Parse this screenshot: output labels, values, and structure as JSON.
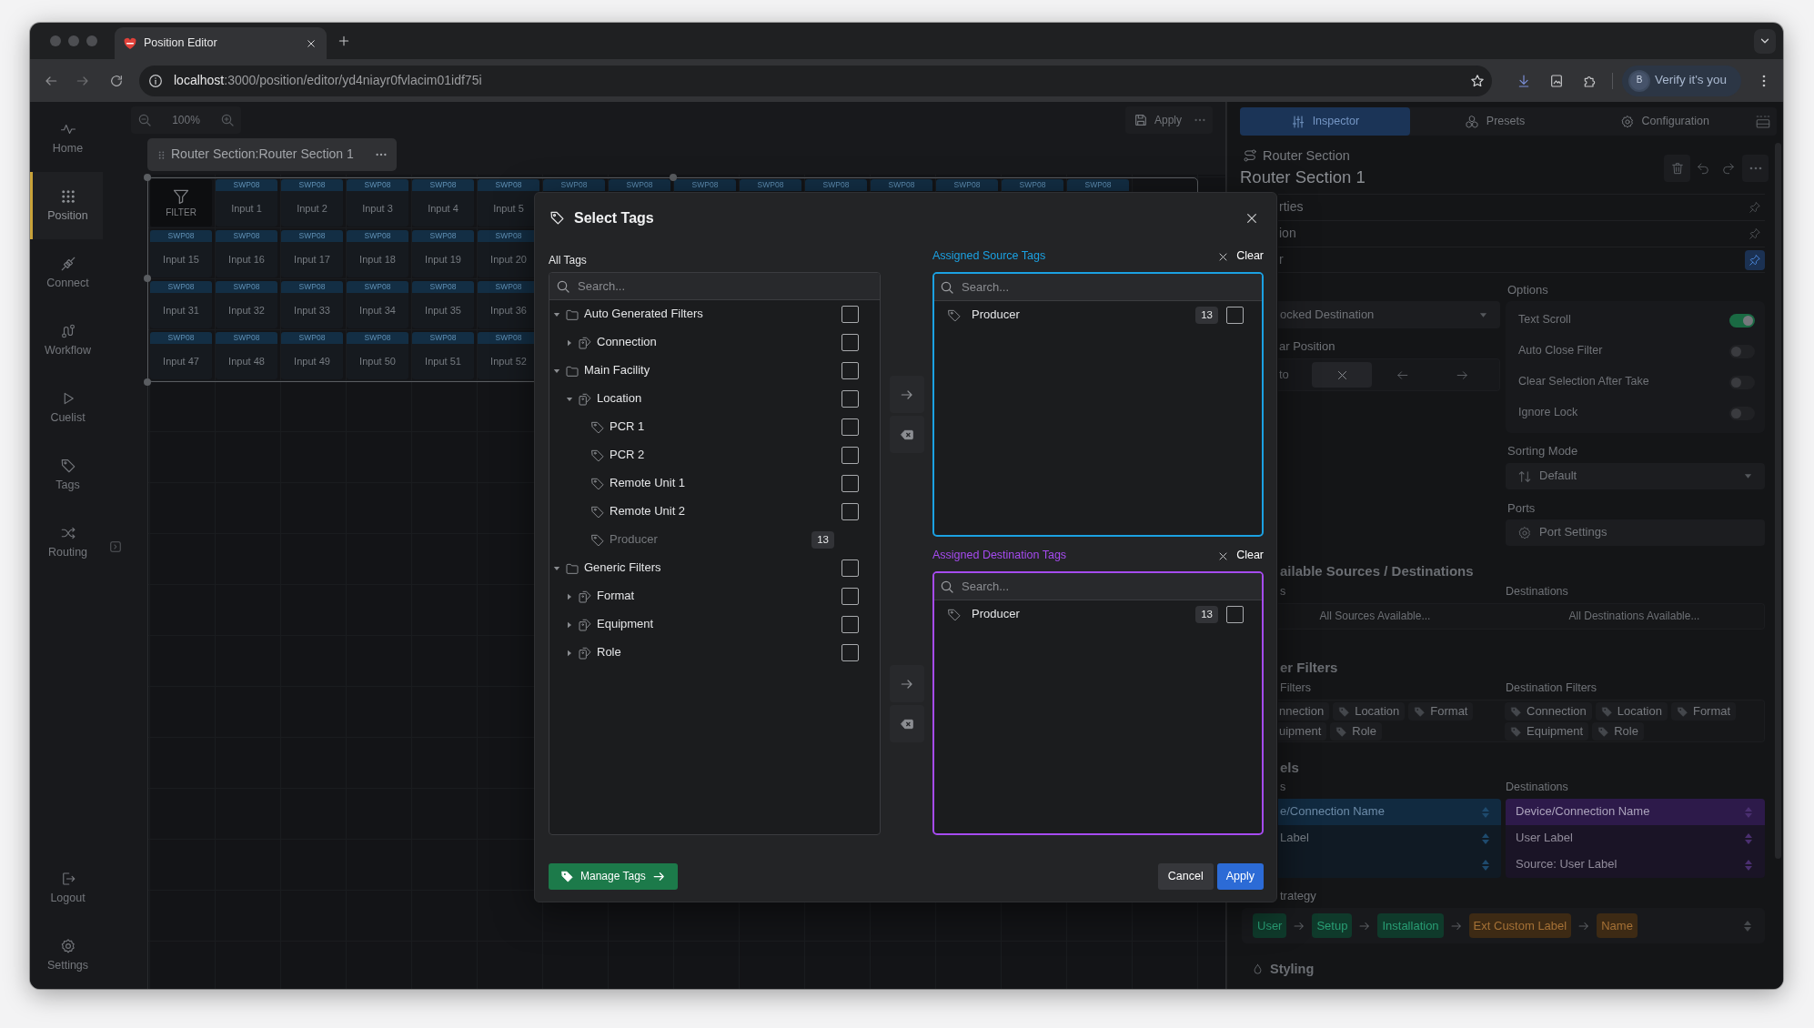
{
  "browser": {
    "tabs": [
      {
        "title": "Position Editor",
        "selected": true
      }
    ],
    "url": {
      "host": "localhost",
      "path": ":3000/position/editor/yd4niayr0fvlacim01idf75i"
    },
    "profile": {
      "initial": "B",
      "label": "Verify it's you"
    }
  },
  "sidebar": {
    "items": [
      {
        "label": "Home",
        "selected": false
      },
      {
        "label": "Position",
        "selected": true
      },
      {
        "label": "Connect",
        "selected": false
      },
      {
        "label": "Workflow",
        "selected": false
      },
      {
        "label": "Cuelist",
        "selected": false
      },
      {
        "label": "Tags",
        "selected": false
      },
      {
        "label": "Routing",
        "selected": false
      }
    ],
    "footer": [
      {
        "label": "Logout"
      },
      {
        "label": "Settings"
      }
    ]
  },
  "canvas": {
    "zoom": "100%",
    "apply": "Apply",
    "section_tab": "Router Section:Router Section 1",
    "rows": [
      [
        {
          "kind": "filter",
          "label": "FILTER"
        },
        {
          "kind": "input",
          "device": "SWP08",
          "label": "Input 1"
        },
        {
          "kind": "input",
          "device": "SWP08",
          "label": "Input 2"
        },
        {
          "kind": "input",
          "device": "SWP08",
          "label": "Input 3"
        },
        {
          "kind": "input",
          "device": "SWP08",
          "label": "Input 4"
        },
        {
          "kind": "input",
          "device": "SWP08",
          "label": "Input 5"
        },
        {
          "kind": "input",
          "device": "SWP08"
        },
        {
          "kind": "input",
          "device": "SWP08"
        },
        {
          "kind": "input",
          "device": "SWP08"
        },
        {
          "kind": "input",
          "device": "SWP08"
        },
        {
          "kind": "input",
          "device": "SWP08"
        },
        {
          "kind": "input",
          "device": "SWP08"
        },
        {
          "kind": "input",
          "device": "SWP08"
        },
        {
          "kind": "input",
          "device": "SWP08"
        },
        {
          "kind": "input",
          "device": "SWP08"
        }
      ],
      [
        {
          "kind": "input",
          "device": "SWP08",
          "label": "Input 15"
        },
        {
          "kind": "input",
          "device": "SWP08",
          "label": "Input 16"
        },
        {
          "kind": "input",
          "device": "SWP08",
          "label": "Input 17"
        },
        {
          "kind": "input",
          "device": "SWP08",
          "label": "Input 18"
        },
        {
          "kind": "input",
          "device": "SWP08",
          "label": "Input 19"
        },
        {
          "kind": "input",
          "device": "SWP08",
          "label": "Input 20"
        }
      ],
      [
        {
          "kind": "input",
          "device": "SWP08",
          "label": "Input 31"
        },
        {
          "kind": "input",
          "device": "SWP08",
          "label": "Input 32"
        },
        {
          "kind": "input",
          "device": "SWP08",
          "label": "Input 33"
        },
        {
          "kind": "input",
          "device": "SWP08",
          "label": "Input 34"
        },
        {
          "kind": "input",
          "device": "SWP08",
          "label": "Input 35"
        },
        {
          "kind": "input",
          "device": "SWP08",
          "label": "Input 36"
        }
      ],
      [
        {
          "kind": "input",
          "device": "SWP08",
          "label": "Input 47"
        },
        {
          "kind": "input",
          "device": "SWP08",
          "label": "Input 48"
        },
        {
          "kind": "input",
          "device": "SWP08",
          "label": "Input 49"
        },
        {
          "kind": "input",
          "device": "SWP08",
          "label": "Input 50"
        },
        {
          "kind": "input",
          "device": "SWP08",
          "label": "Input 51"
        },
        {
          "kind": "input",
          "device": "SWP08",
          "label": "Input 52"
        }
      ]
    ]
  },
  "dialog": {
    "title": "Select Tags",
    "all_tags": {
      "label": "All Tags",
      "search_placeholder": "Search...",
      "tree": [
        {
          "kind": "folder",
          "label": "Auto Generated Filters",
          "expanded": true,
          "checked": false,
          "children": [
            {
              "kind": "group",
              "label": "Connection",
              "expanded": false,
              "checked": false
            }
          ]
        },
        {
          "kind": "folder",
          "label": "Main Facility",
          "expanded": true,
          "checked": false,
          "children": [
            {
              "kind": "group",
              "label": "Location",
              "expanded": true,
              "checked": false,
              "children": [
                {
                  "kind": "tag",
                  "label": "PCR 1",
                  "disabled": false,
                  "checked": false
                },
                {
                  "kind": "tag",
                  "label": "PCR 2",
                  "disabled": false,
                  "checked": false
                },
                {
                  "kind": "tag",
                  "label": "Remote Unit 1",
                  "disabled": false,
                  "checked": false
                },
                {
                  "kind": "tag",
                  "label": "Remote Unit 2",
                  "disabled": false,
                  "checked": false
                },
                {
                  "kind": "tag",
                  "label": "Producer",
                  "disabled": true,
                  "count": "13"
                }
              ]
            }
          ]
        },
        {
          "kind": "folder",
          "label": "Generic Filters",
          "expanded": true,
          "checked": false,
          "children": [
            {
              "kind": "group",
              "label": "Format",
              "expanded": false,
              "checked": false
            },
            {
              "kind": "group",
              "label": "Equipment",
              "expanded": false,
              "checked": false
            },
            {
              "kind": "group",
              "label": "Role",
              "expanded": false,
              "checked": false
            }
          ]
        }
      ]
    },
    "assigned": [
      {
        "label": "Assigned Source Tags",
        "color": "#1ba1e2",
        "clear": "Clear",
        "search_placeholder": "Search...",
        "items": [
          {
            "label": "Producer",
            "count": "13",
            "checked": false
          }
        ]
      },
      {
        "label": "Assigned Destination Tags",
        "color": "#a64bf0",
        "clear": "Clear",
        "search_placeholder": "Search...",
        "items": [
          {
            "label": "Producer",
            "count": "13",
            "checked": false
          }
        ]
      }
    ],
    "manage": "Manage Tags",
    "cancel": "Cancel",
    "apply": "Apply"
  },
  "inspector": {
    "tabs": [
      {
        "label": "Inspector",
        "selected": true
      },
      {
        "label": "Presets",
        "selected": false
      },
      {
        "label": "Configuration",
        "selected": false
      }
    ],
    "type": "Router Section",
    "title": "Router Section 1",
    "sections": [
      {
        "label": "rties",
        "pinned": false
      },
      {
        "label": "ion",
        "pinned": false
      },
      {
        "label": "r",
        "pinned": true
      }
    ],
    "destination_mode": {
      "value": "ocked Destination"
    },
    "position": {
      "label": "ar Position",
      "options": [
        {
          "kind": "text",
          "label": "to",
          "selected": false
        },
        {
          "kind": "clear",
          "selected": true
        },
        {
          "kind": "left",
          "selected": false
        },
        {
          "kind": "right",
          "selected": false
        }
      ]
    },
    "options": {
      "label": "Options",
      "items": [
        {
          "label": "Text Scroll",
          "on": true
        },
        {
          "label": "Auto Close Filter",
          "on": false
        },
        {
          "label": "Clear Selection After Take",
          "on": false
        },
        {
          "label": "Ignore Lock",
          "on": false
        }
      ]
    },
    "sorting": {
      "label": "Sorting Mode",
      "value": "Default"
    },
    "ports": {
      "label": "Ports",
      "button": "Port Settings"
    },
    "available": {
      "heading": "ailable Sources / Destinations",
      "sources_label": "s",
      "destinations_label": "Destinations",
      "sources_value": "All Sources Available...",
      "destinations_value": "All Destinations Available..."
    },
    "filters": {
      "heading": "er Filters",
      "sources_label": "Filters",
      "destinations_label": "Destination Filters",
      "source_rows": [
        [
          "nnection",
          "Location",
          "Format"
        ],
        [
          "uipment",
          "Role"
        ]
      ],
      "destination_rows": [
        [
          "Connection",
          "Location",
          "Format"
        ],
        [
          "Equipment",
          "Role"
        ]
      ]
    },
    "labels": {
      "heading": "els",
      "sources_label": "s",
      "destinations_label": "Destinations",
      "sources": [
        {
          "label": "e/Connection Name",
          "selected": true
        },
        {
          "label": "Label",
          "selected": false
        },
        {
          "selected": false
        }
      ],
      "destinations": [
        {
          "label": "Device/Connection Name",
          "selected": true
        },
        {
          "label": "User Label",
          "selected": false
        },
        {
          "label": "Source: User Label",
          "selected": false
        }
      ]
    },
    "strategy": {
      "label": "trategy",
      "chips": [
        {
          "label": "User",
          "color": "#0f3a2b"
        },
        {
          "label": "Setup",
          "color": "#0f3a2b"
        },
        {
          "label": "Installation",
          "color": "#0f3a2b"
        },
        {
          "label": "Ext Custom Label",
          "color": "#3d2a14"
        },
        {
          "label": "Name",
          "color": "#3d2a14"
        }
      ]
    },
    "styling": "Styling"
  }
}
